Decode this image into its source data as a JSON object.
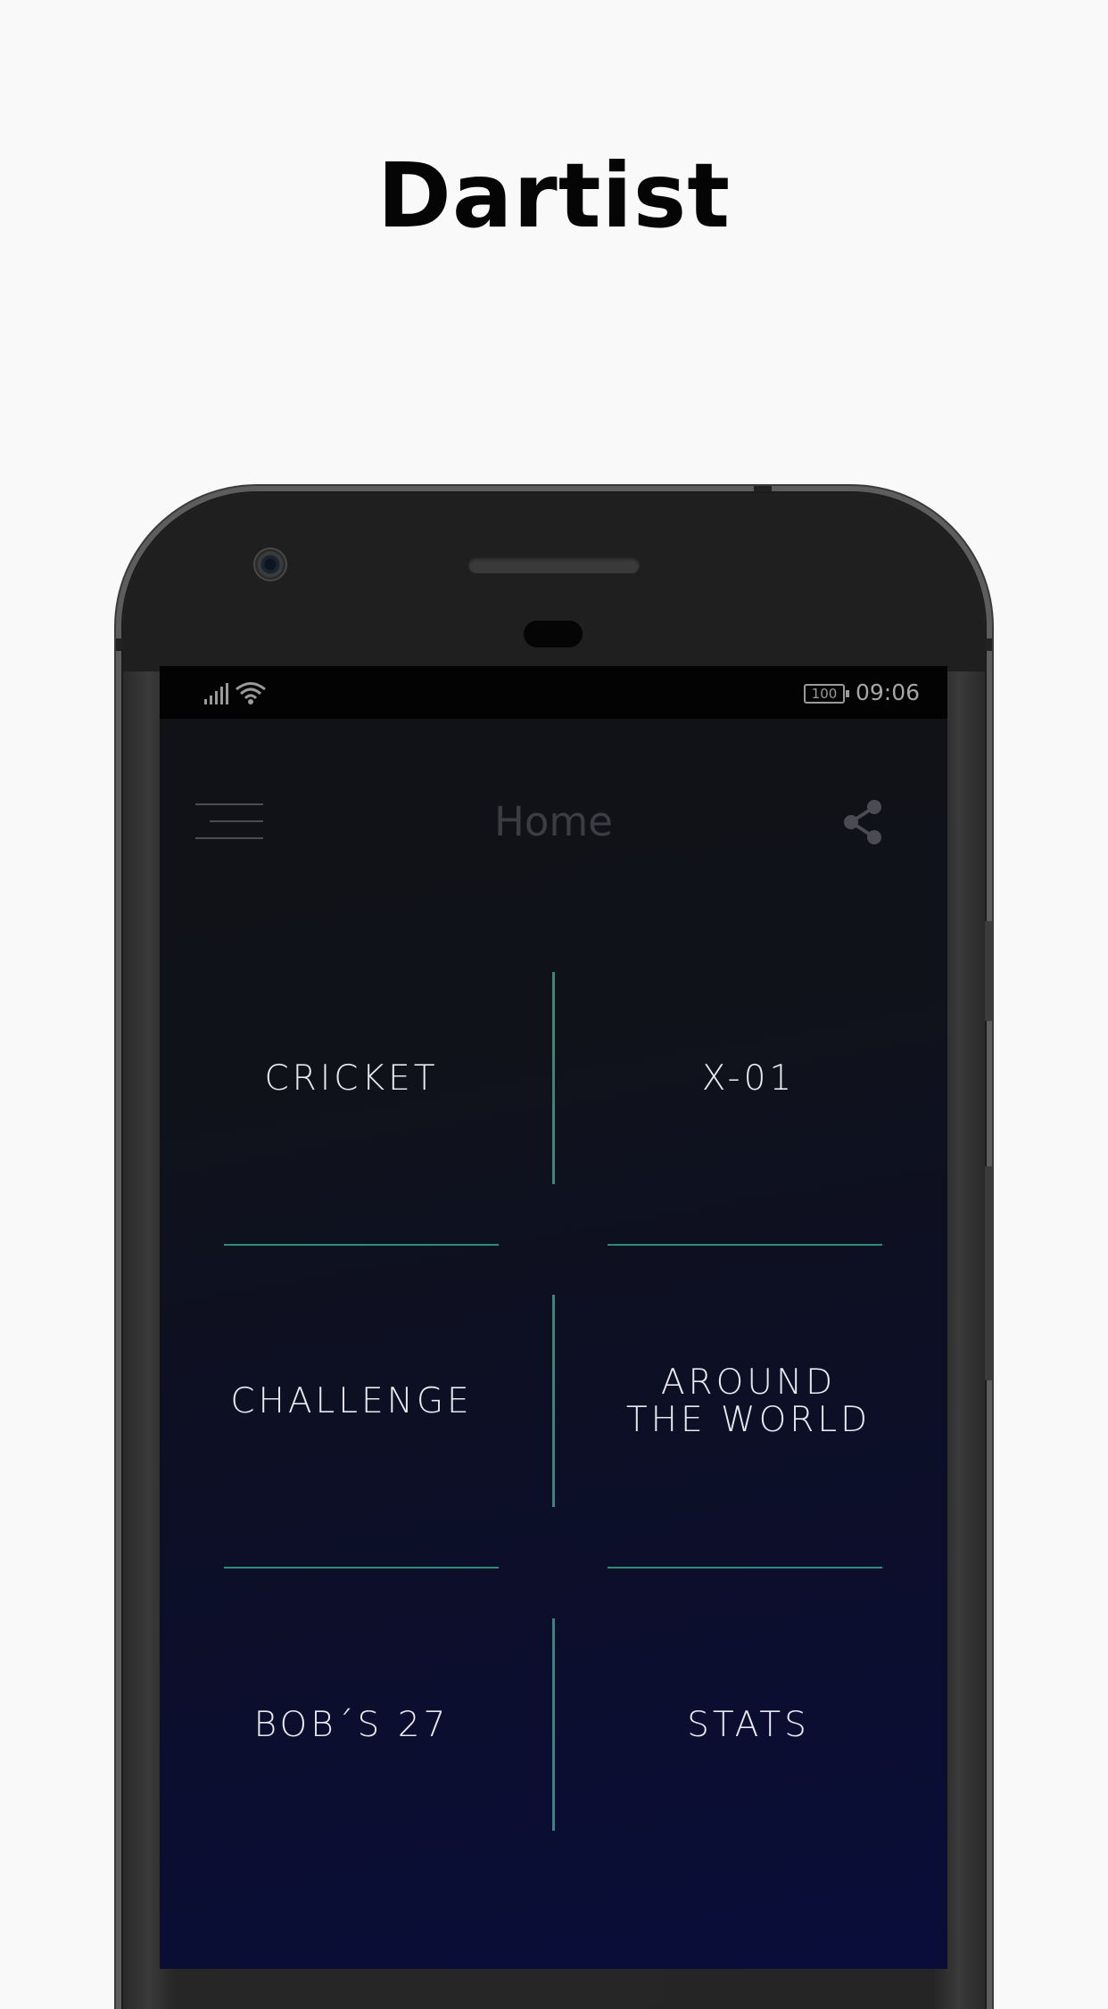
{
  "header": {
    "title": "Dartist"
  },
  "status_bar": {
    "battery": "100",
    "time": "09:06"
  },
  "app_bar": {
    "title": "Home",
    "menu_icon": "menu-icon",
    "share_icon": "share-icon"
  },
  "menu": {
    "items": [
      {
        "label": "CRICKET"
      },
      {
        "label": "X-01"
      },
      {
        "label": "CHALLENGE"
      },
      {
        "label": "AROUND\nTHE WORLD"
      },
      {
        "label": "BOB´S 27"
      },
      {
        "label": "STATS"
      }
    ]
  },
  "colors": {
    "accent": "#2a8f78",
    "page_background": "#f9f9f9",
    "screen_top": "#101216",
    "screen_bottom": "#0a0d3a"
  }
}
